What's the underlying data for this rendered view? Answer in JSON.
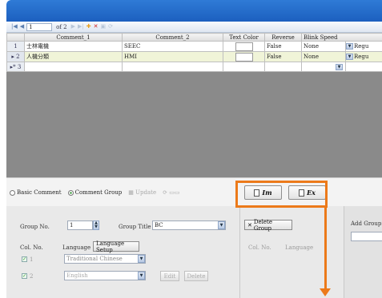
{
  "toolbar": {
    "position": "1",
    "of_label": "of 2"
  },
  "grid": {
    "columns": [
      "",
      "Comment_1",
      "Comment_2",
      "Text Color",
      "Reverse",
      "Blink Speed"
    ],
    "rows": [
      {
        "header": "1",
        "comment1": "士林電機",
        "comment2": "SEEC",
        "reverse": "False",
        "blink": "None",
        "extra": "Regu"
      },
      {
        "header": "▸ 2",
        "comment1": "人機分類",
        "comment2": "HMI",
        "reverse": "False",
        "blink": "None",
        "extra": "Regu"
      },
      {
        "header": "▸* 3",
        "comment1": "",
        "comment2": "",
        "reverse": "",
        "blink": "",
        "extra": ""
      }
    ]
  },
  "mode": {
    "basic_comment": "Basic Comment",
    "comment_group": "Comment Group",
    "update": "Update",
    "import_label": "Im",
    "export_label": "Ex"
  },
  "lower": {
    "group_no_label": "Group No.",
    "group_no_value": "1",
    "group_title_label": "Group Title",
    "group_title_value": "BC",
    "delete_group": "Delete Group",
    "add_group": "Add Group",
    "col_no": "Col. No.",
    "language": "Language",
    "language_setup": "Language Setup",
    "col_no_right": "Col. No.",
    "language_right": "Language",
    "lang_rows": [
      {
        "num": "1",
        "lang": "Traditional Chinese"
      },
      {
        "num": "2",
        "lang": "English"
      }
    ],
    "edit": "Edit",
    "delete": "Delete"
  },
  "colors": {
    "title_bar": "#1c5fbf",
    "highlight": "#ec7a1a"
  }
}
